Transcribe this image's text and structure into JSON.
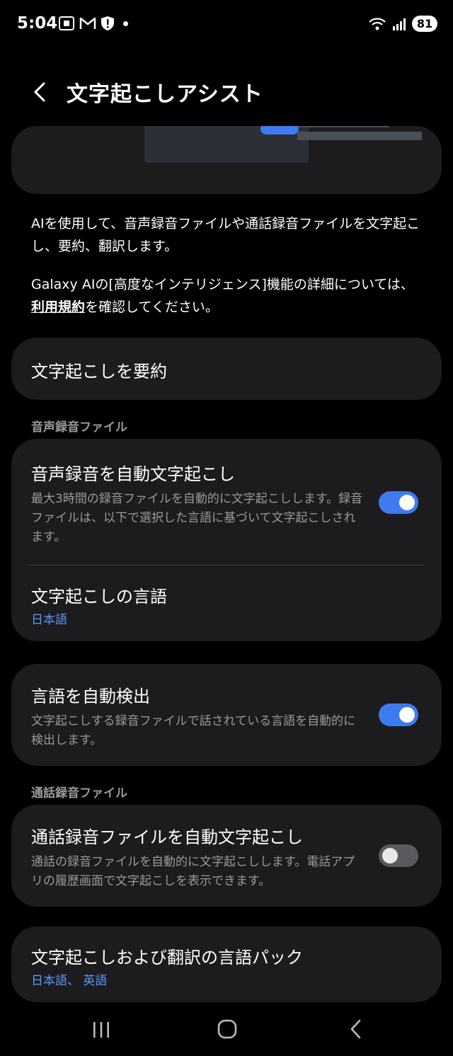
{
  "status_bar": {
    "time": "5:04",
    "battery": "81",
    "left_icons": [
      "screenshot-icon",
      "gmail-icon",
      "shield-alert-icon",
      "notification-dot-icon"
    ],
    "right_icons": [
      "wifi-icon",
      "signal-icon",
      "battery-icon"
    ]
  },
  "header": {
    "title": "文字起こしアシスト"
  },
  "description": {
    "text1": "AIを使用して、音声録音ファイルや通話録音ファイルを文字起こし、要約、翻訳します。",
    "text2_before": "Galaxy AIの[高度なインテリジェンス]機能の詳細については、",
    "text2_link": "利用規約",
    "text2_after": "を確認してください。"
  },
  "summarize_item": {
    "title": "文字起こしを要約"
  },
  "section_voice": {
    "label": "音声録音ファイル",
    "auto_transcribe": {
      "title": "音声録音を自動文字起こし",
      "description": "最大3時間の録音ファイルを自動的に文字起こしします。録音ファイルは、以下で選択した言語に基づいて文字起こしされます。",
      "enabled": true
    },
    "language": {
      "title": "文字起こしの言語",
      "value": "日本語"
    }
  },
  "auto_detect": {
    "title": "言語を自動検出",
    "description": "文字起こしする録音ファイルで話されている言語を自動的に検出します。",
    "enabled": true
  },
  "section_call": {
    "label": "通話録音ファイル",
    "auto_transcribe": {
      "title": "通話録音ファイルを自動文字起こし",
      "description": "通話の録音ファイルを自動的に文字起こしします。電話アプリの履歴画面で文字起こしを表示できます。",
      "enabled": false
    }
  },
  "language_pack": {
    "title": "文字起こしおよび翻訳の言語パック",
    "value": "日本語、 英語"
  },
  "nav_bar": {
    "icons": [
      "recent-apps-icon",
      "home-icon",
      "back-icon"
    ]
  },
  "colors": {
    "accent": "#3e7bf0",
    "link_value": "#5e97f6",
    "card_bg": "#1c1c1e",
    "secondary_text": "#9a9a9f"
  }
}
